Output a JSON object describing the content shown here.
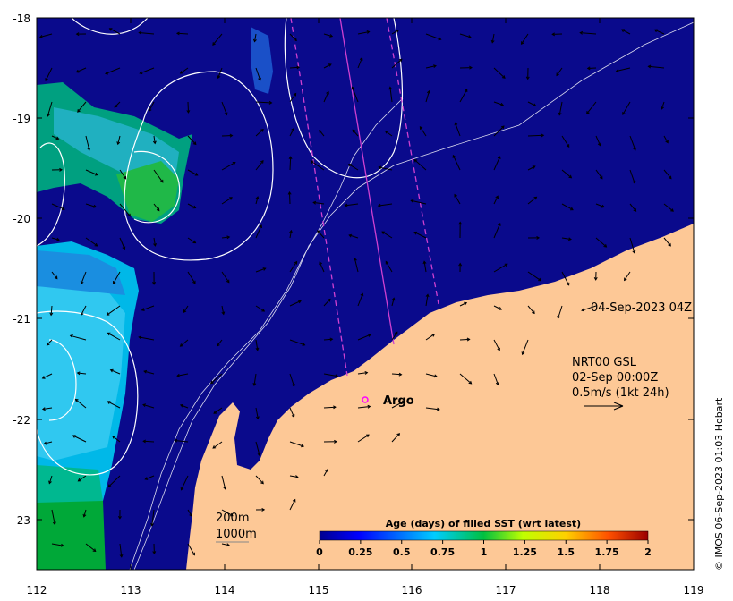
{
  "map": {
    "x_axis_ticks": [
      "112",
      "113",
      "114",
      "115",
      "116",
      "117",
      "118",
      "119"
    ],
    "y_axis_ticks": [
      "-18",
      "-19",
      "-20",
      "-21",
      "-22",
      "-23"
    ],
    "lon_range": [
      112,
      119
    ],
    "lat_range": [
      -23.5,
      -18
    ],
    "timestamp": "04-Sep-2023 04Z",
    "current_label": {
      "source": "NRT00 GSL",
      "time": "02-Sep 00:00Z",
      "scale": "0.5m/s (1kt 24h)"
    },
    "argo": {
      "label": "Argo",
      "lon": 115.5,
      "lat": -21.8
    },
    "depth_contours": [
      "200m",
      "1000m"
    ],
    "colorbar": {
      "title": "Age (days) of filled SST (wrt latest)",
      "ticks": [
        "0",
        "0.25",
        "0.5",
        "0.75",
        "1",
        "1.25",
        "1.5",
        "1.75",
        "2"
      ],
      "range": [
        0,
        2
      ]
    },
    "credit": "© IMOS 06-Sep-2023 01:03 Hobart",
    "colors": {
      "ocean": "#0a0a8c",
      "land": "#fdc896",
      "argo_marker": "#ff00ff",
      "track_line": "#d040d0",
      "contour": "#ffffff"
    }
  }
}
